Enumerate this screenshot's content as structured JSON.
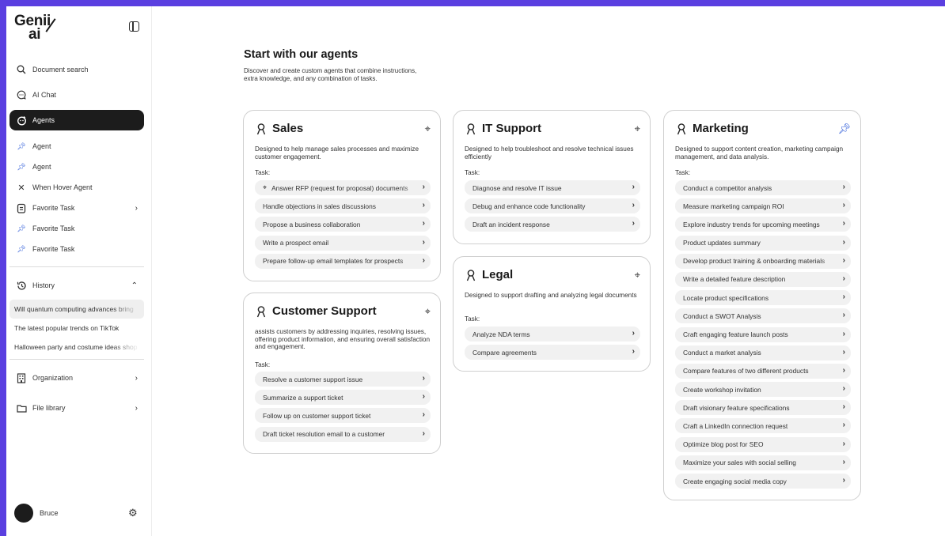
{
  "sidebar": {
    "logo_line1": "Genii",
    "logo_line2": "ai",
    "nav": [
      {
        "label": "Document search",
        "icon": "search-icon"
      },
      {
        "label": "AI Chat",
        "icon": "chat-icon"
      },
      {
        "label": "Agents",
        "icon": "agents-icon",
        "active": true
      }
    ],
    "pinned_agents": [
      "Agent",
      "Agent"
    ],
    "hover_agent": "When Hover Agent",
    "favorite_task": "Favorite Task",
    "favorite_items": [
      "Favorite Task",
      "Favorite Task"
    ],
    "history_label": "History",
    "history": [
      "Will quantum computing advances bring",
      "The latest popular trends on TikTok",
      "Halloween party and costume ideas shop"
    ],
    "organization": "Organization",
    "file_library": "File library",
    "user_name": "Bruce"
  },
  "main": {
    "title": "Start with our agents",
    "description": "Discover and create custom agents that combine instructions, extra knowledge, and any combination of tasks."
  },
  "task_label": "Task:",
  "cards": {
    "sales": {
      "title": "Sales",
      "description": "Designed to help manage sales processes and maximize customer engagement.",
      "tasks": [
        "Answer RFP (request for proposal) documents",
        "Handle objections in sales discussions",
        "Propose a business collaboration",
        "Write a prospect email",
        "Prepare follow-up email templates for prospects"
      ]
    },
    "customer_support": {
      "title": "Customer Support",
      "description": "assists customers by addressing inquiries, resolving issues, offering product information, and ensuring overall satisfaction and engagement.",
      "tasks": [
        "Resolve a customer support issue",
        "Summarize a support ticket",
        "Follow up on customer support ticket",
        "Draft ticket resolution email to a customer"
      ]
    },
    "it_support": {
      "title": "IT Support",
      "description": "Designed to help troubleshoot and resolve technical issues efficiently",
      "tasks": [
        "Diagnose and resolve IT issue",
        "Debug and enhance code functionality",
        "Draft an incident response"
      ]
    },
    "legal": {
      "title": "Legal",
      "description": "Designed to support drafting and analyzing legal documents",
      "tasks": [
        "Analyze NDA terms",
        "Compare agreements"
      ]
    },
    "marketing": {
      "title": "Marketing",
      "description": "Designed to support content creation, marketing campaign management, and data analysis.",
      "tasks": [
        "Conduct a competitor analysis",
        "Measure marketing campaign ROI",
        "Explore industry trends for upcoming meetings",
        "Product updates summary",
        "Develop product training & onboarding materials",
        "Write a detailed feature description",
        "Locate product specifications",
        "Conduct a SWOT Analysis",
        "Craft engaging feature launch posts",
        "Conduct a market analysis",
        "Compare features of two different products",
        "Create workshop invitation",
        "Draft visionary feature specifications",
        "Craft a LinkedIn connection request",
        "Optimize blog post for SEO",
        "Maximize your sales with social selling",
        "Create engaging social media copy"
      ]
    }
  },
  "colors": {
    "background": "#5a3fe0",
    "active_nav": "#1c1c1c",
    "pin_accent": "#2d5bd8",
    "task_bg": "#f1f1f1"
  }
}
